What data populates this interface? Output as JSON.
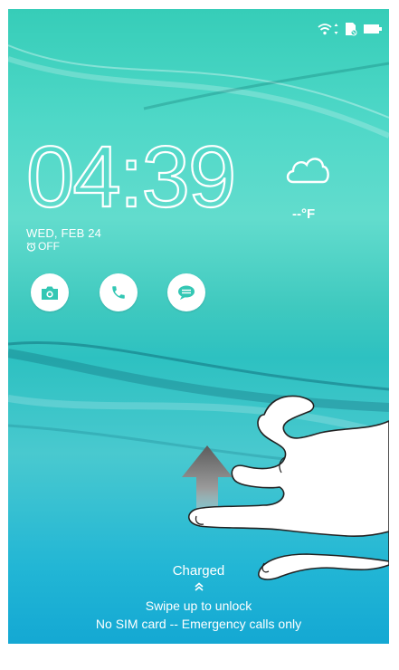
{
  "status_bar": {
    "icons": [
      "wifi-icon",
      "data-arrows-icon",
      "sim-card-icon",
      "battery-icon"
    ]
  },
  "clock": {
    "time": "04:39"
  },
  "date": {
    "text": "WED, FEB 24"
  },
  "alarm": {
    "label": "OFF",
    "icon": "alarm-clock-icon"
  },
  "weather": {
    "icon": "cloud-icon",
    "temperature": "--°F"
  },
  "shortcuts": [
    {
      "name": "camera",
      "icon": "camera-icon"
    },
    {
      "name": "phone",
      "icon": "phone-icon"
    },
    {
      "name": "messages",
      "icon": "message-icon"
    }
  ],
  "bottom": {
    "charging_status": "Charged",
    "chevron": "chevron-up-icon",
    "unlock_hint": "Swipe up to unlock",
    "sim_status": "No SIM card -- Emergency calls only"
  },
  "colors": {
    "bg_top": "#36cdb8",
    "bg_mid": "#2dc1c1",
    "bg_bottom": "#14a8d3",
    "icon_accent": "#33c7b4"
  }
}
